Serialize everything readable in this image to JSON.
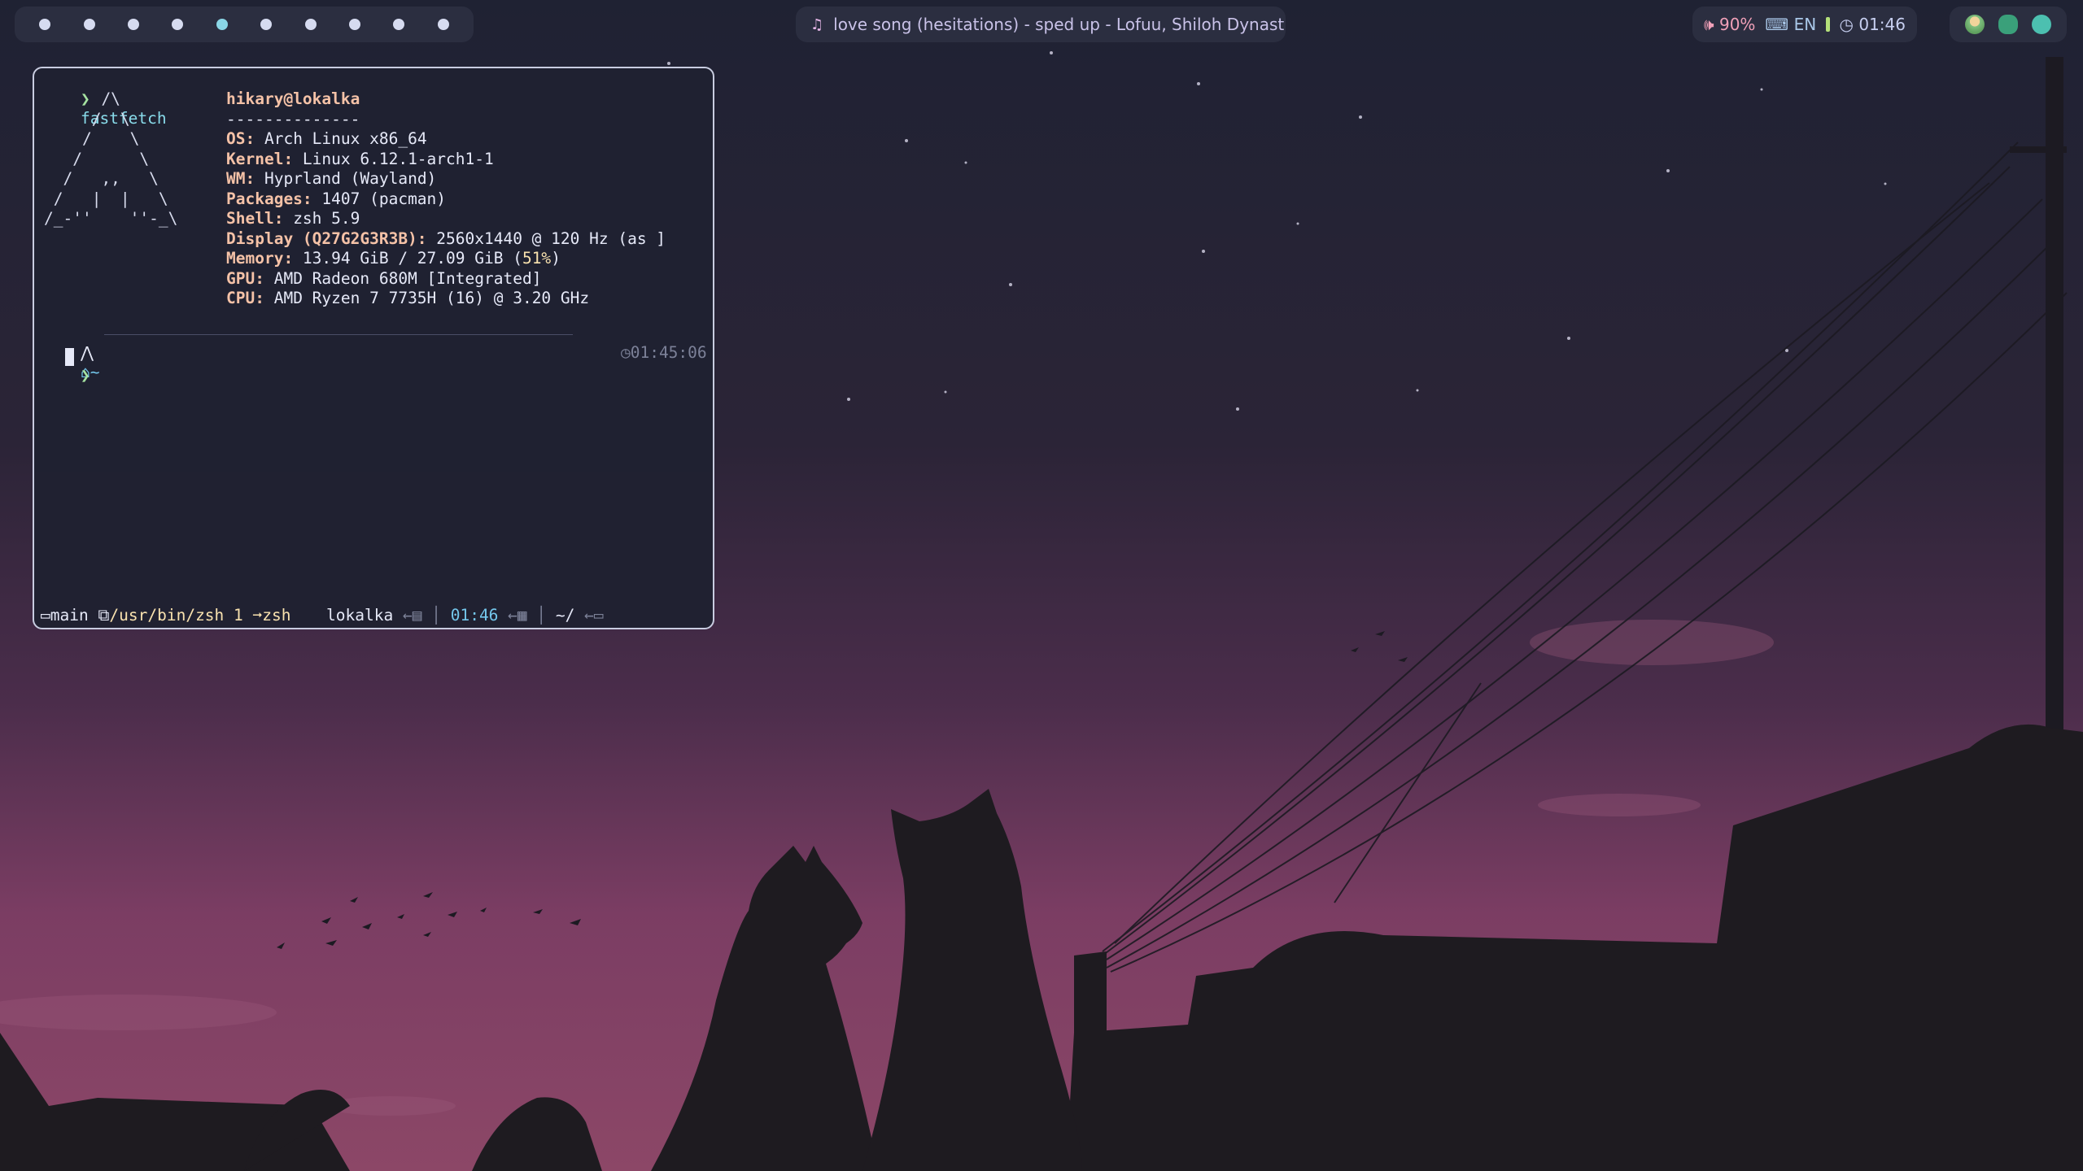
{
  "topbar": {
    "workspaces": [
      {
        "active": false
      },
      {
        "active": false
      },
      {
        "active": false
      },
      {
        "active": false
      },
      {
        "active": true
      },
      {
        "active": false
      },
      {
        "active": false
      },
      {
        "active": false
      },
      {
        "active": false
      },
      {
        "active": false
      }
    ],
    "media": {
      "icon": "music-note-icon",
      "title": "love song (hesitations) - sped up - Lofuu, Shiloh Dynast…"
    },
    "status": {
      "volume_icon": "speaker-icon",
      "volume": "90%",
      "keyboard_icon": "keyboard-icon",
      "keyboard_layout": "EN",
      "battery_icon": "battery-icon",
      "clock_icon": "clock-icon",
      "time": "01:46"
    },
    "tray": [
      "user-icon",
      "bluetooth-icon",
      "network-icon"
    ]
  },
  "terminal": {
    "command_prompt": "❯",
    "command": "fastfetch",
    "ascii_logo": "      /\\\n     /  \\\n    /    \\\n   /      \\\n  /   ,,   \\\n /   |  |   \\\n/_-''    ''-_\\",
    "user_host": "hikary@lokalka",
    "separator": "--------------",
    "info": {
      "os_key": "OS:",
      "os": " Arch Linux x86_64",
      "kernel_key": "Kernel:",
      "kernel": " Linux 6.12.1-arch1-1",
      "wm_key": "WM:",
      "wm": " Hyprland (Wayland)",
      "packages_key": "Packages:",
      "packages": " 1407 (pacman)",
      "shell_key": "Shell:",
      "shell": " zsh 5.9",
      "display_key": "Display (Q27G2G3R3B):",
      "display": " 2560x1440 @ 120 Hz (as ]",
      "memory_key": "Memory:",
      "memory": " 13.94 GiB / 27.09 GiB (",
      "memory_pct": "51%",
      "memory_close": ")",
      "gpu_key": "GPU:",
      "gpu": " AMD Radeon 680M [Integrated]",
      "cpu_key": "CPU:",
      "cpu": " AMD Ryzen 7 7735H (16) @ 3.20 GHz"
    },
    "prompt": {
      "os_icon": "arch-icon",
      "home_icon": "home-icon",
      "dir": "~",
      "clock_icon": "clock-icon",
      "time": "01:45:06",
      "input_prompt": "❯"
    },
    "statusline": {
      "session_icon": "window-icon",
      "session": "main",
      "pane_icon": "pane-icon",
      "path": "/usr/bin/zsh",
      "index": "1",
      "arrow": "➞",
      "program": "zsh",
      "host": "lokalka",
      "host_icon": "server-icon",
      "time": "01:46",
      "calendar_icon": "calendar-icon",
      "cwd": "~/",
      "folder_icon": "folder-icon",
      "left_arrow": "←"
    }
  }
}
